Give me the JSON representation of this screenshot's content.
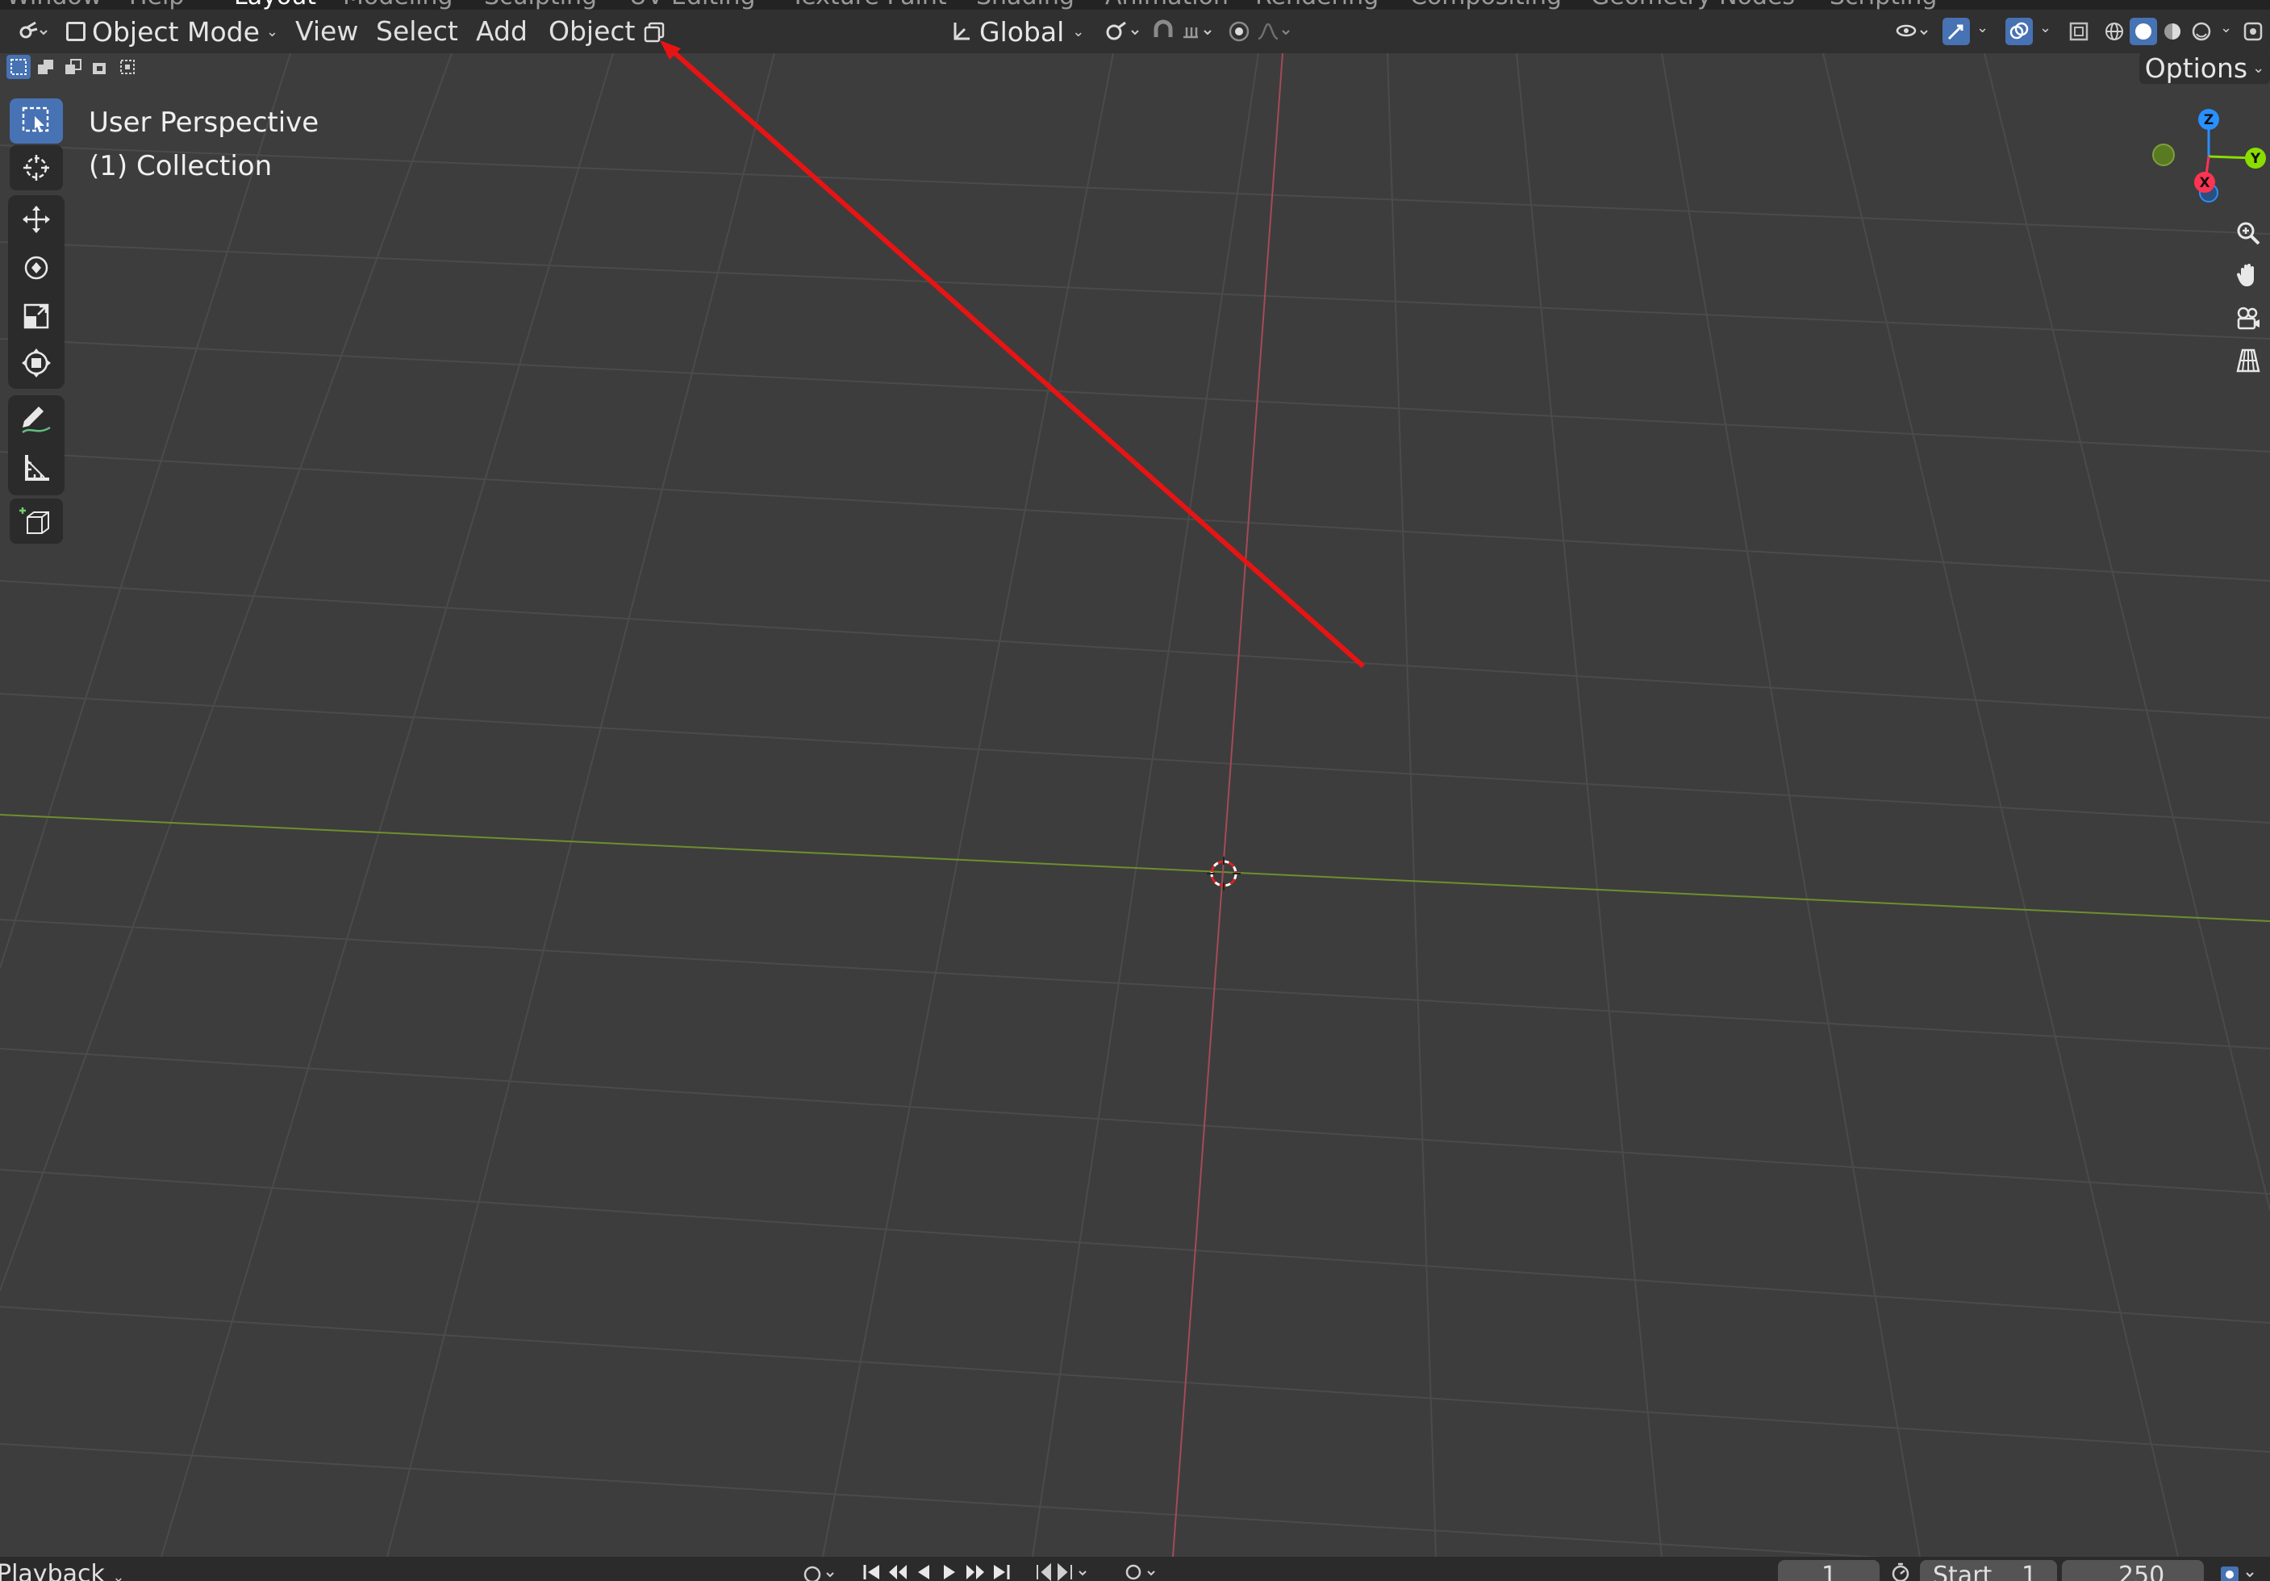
{
  "top_bar": {
    "menus": [
      "Window",
      "Help"
    ],
    "workspace_tabs": [
      "Layout",
      "Modeling",
      "Sculpting",
      "UV Editing",
      "Texture Paint",
      "Shading",
      "Animation",
      "Rendering",
      "Compositing",
      "Geometry Nodes",
      "Scripting"
    ],
    "active_tab": "Layout"
  },
  "header": {
    "mode": "Object Mode",
    "menus": [
      "View",
      "Select",
      "Add",
      "Object"
    ],
    "orientation": "Global",
    "options_label": "Options"
  },
  "viewport": {
    "perspective_label": "User Perspective",
    "collection_label": "(1) Collection",
    "gizmo_axes": [
      "Z",
      "Y",
      "X"
    ]
  },
  "toolbar": {
    "tools": [
      "select-box",
      "cursor",
      "move",
      "rotate",
      "scale",
      "transform",
      "annotate",
      "measure",
      "add-cube"
    ],
    "active_tool": "select-box"
  },
  "navigation": [
    "zoom",
    "pan",
    "camera",
    "perspective-toggle"
  ],
  "timeline": {
    "playback_label": "Playback",
    "current_frame": "1",
    "start_label": "Start",
    "start_frame": "1",
    "end_frame": "250"
  },
  "annotation": {
    "color": "#ff0000",
    "description_target": "object-menu-icon"
  },
  "colors": {
    "accent": "#4772b3",
    "x_axis": "#ff3352",
    "y_axis": "#8bdc00",
    "z_axis": "#2890ff",
    "background": "#3d3d3d"
  }
}
